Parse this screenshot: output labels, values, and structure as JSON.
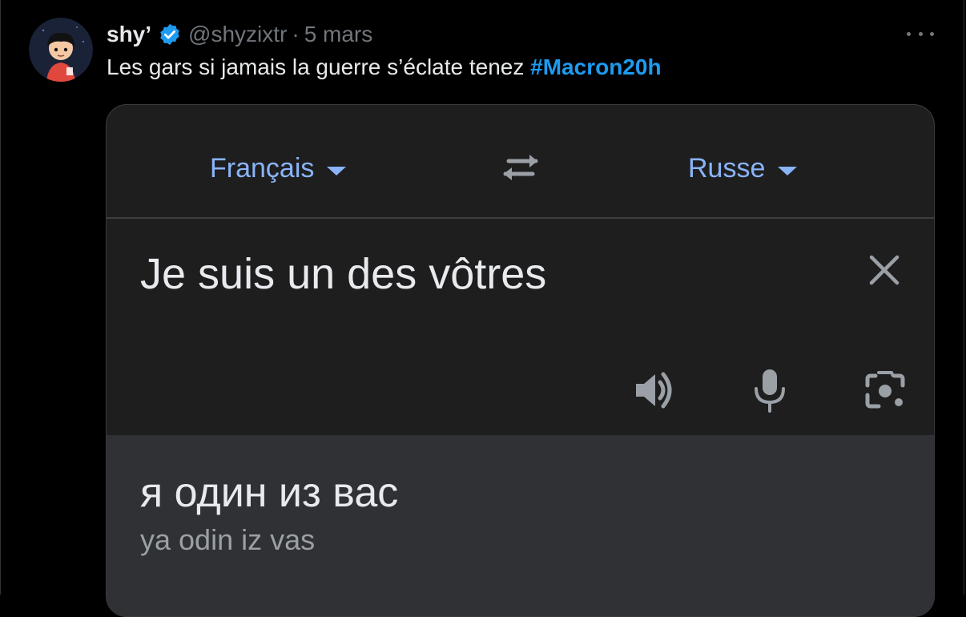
{
  "tweet": {
    "author_name": "shy’",
    "handle": "@shyzixtr",
    "separator": "·",
    "date": "5 mars",
    "text": "Les gars si jamais la guerre s’éclate tenez ",
    "hashtag": "#Macron20h"
  },
  "translate": {
    "source_language": "Français",
    "target_language": "Russe",
    "source_text": "Je suis un des vôtres",
    "translation": "я один из вас",
    "transliteration": "ya odin iz vas"
  },
  "icons": {
    "verified": "verified-badge-icon",
    "more": "more-options-icon",
    "swap": "swap-languages-icon",
    "clear": "close-icon",
    "speaker": "speaker-icon",
    "mic": "microphone-icon",
    "lens": "camera-lens-icon"
  },
  "colors": {
    "link": "#1d9bf0",
    "language": "#8ab4f8",
    "background": "#000000",
    "card": "#1e1e1f",
    "result_panel": "#303134"
  }
}
